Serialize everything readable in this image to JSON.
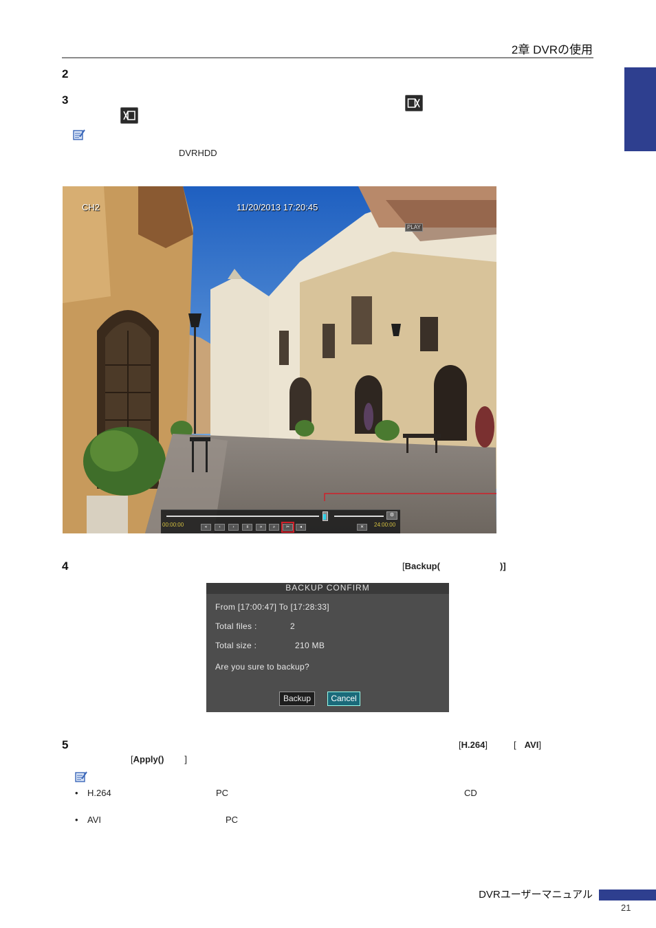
{
  "header": {
    "chapter_title": "2章 DVRの使用"
  },
  "steps": {
    "step2": {
      "number": "2"
    },
    "step3": {
      "number": "3"
    },
    "note1": {
      "text": "DVRHDD"
    },
    "step4": {
      "number": "4",
      "bracket_open": "[",
      "button_label": "Backup(",
      "button_close": ")]"
    },
    "step5": {
      "number": "5",
      "h264_open": "[",
      "h264": "H.264",
      "h264_close": "]",
      "avi_open": "[",
      "avi": "AVI",
      "avi_close": "]",
      "apply_open": "[",
      "apply": "Apply()",
      "apply_close": "]"
    }
  },
  "video": {
    "channel": "CH2",
    "timestamp": "11/20/2013 17:20:45",
    "play_badge": "PLAY",
    "start_time": "00:00:00",
    "end_time": "24:00:00"
  },
  "backup_dialog": {
    "title": "BACKUP CONFIRM",
    "range": "From [17:00:47] To [17:28:33]",
    "total_files_label": "Total files :",
    "total_files_value": "2",
    "total_size_label": "Total size :",
    "total_size_value": "210 MB",
    "question": "Are you sure to backup?",
    "backup_button": "Backup",
    "cancel_button": "Cancel"
  },
  "notes2": {
    "bullet1": {
      "a": "H.264",
      "b": "PC",
      "c": "CD"
    },
    "bullet2": {
      "a": "AVI",
      "b": "PC"
    }
  },
  "footer": {
    "title": "DVRユーザーマニュアル",
    "page": "21"
  },
  "colors": {
    "accent": "#2e3f8f",
    "highlight": "#d0202a",
    "dialog_bg": "#4d4d4d"
  }
}
